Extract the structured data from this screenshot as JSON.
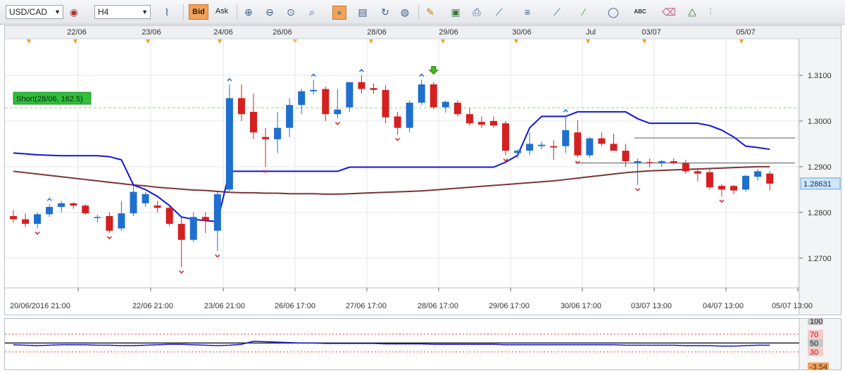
{
  "toolbar": {
    "symbol": "USD/CAD",
    "timeframe": "H4",
    "bid_label": "Bid",
    "ask_label": "Ask",
    "abc_label": "ABC"
  },
  "chart_data": [
    {
      "type": "candlestick",
      "top_date_labels": [
        "22/06",
        "23/06",
        "24/06",
        "26/06",
        "28/06",
        "29/06",
        "30/06",
        "Jul",
        "03/07",
        "05/07"
      ],
      "bottom_date_labels": [
        "20/06/2016 21:00",
        "22/06 21:00",
        "23/06 21:00",
        "26/06 17:00",
        "27/06 17:00",
        "28/06 17:00",
        "29/06 17:00",
        "30/06 17:00",
        "03/07 13:00",
        "04/07 13:00",
        "05/07 13:00"
      ],
      "y_ticks": [
        "1.3100",
        "1.3000",
        "1.2900",
        "1.2800",
        "1.2700"
      ],
      "ylim": [
        1.2635,
        1.318
      ],
      "current_price": "1.28631",
      "position_label": "Short(28/06, 162.5)",
      "position_price": 1.3029,
      "horizontal_lines": [
        1.2963,
        1.2908
      ],
      "colors": {
        "bull": "#1f6fcf",
        "bear": "#d42020",
        "channel": "#1414d8",
        "ma": "#7a3535",
        "position": "#2fbf3a"
      },
      "candles": [
        {
          "o": 1.2792,
          "h": 1.2805,
          "l": 1.2778,
          "c": 1.2785
        },
        {
          "o": 1.2785,
          "h": 1.2798,
          "l": 1.2768,
          "c": 1.2775
        },
        {
          "o": 1.2775,
          "h": 1.28,
          "l": 1.2765,
          "c": 1.2796
        },
        {
          "o": 1.2796,
          "h": 1.2818,
          "l": 1.279,
          "c": 1.2812
        },
        {
          "o": 1.2812,
          "h": 1.2825,
          "l": 1.28,
          "c": 1.282
        },
        {
          "o": 1.282,
          "h": 1.2822,
          "l": 1.2808,
          "c": 1.2815
        },
        {
          "o": 1.2815,
          "h": 1.2818,
          "l": 1.2795,
          "c": 1.2798
        },
        {
          "o": 1.279,
          "h": 1.2795,
          "l": 1.2778,
          "c": 1.279
        },
        {
          "o": 1.2792,
          "h": 1.28,
          "l": 1.2755,
          "c": 1.276
        },
        {
          "o": 1.2765,
          "h": 1.2825,
          "l": 1.276,
          "c": 1.2798
        },
        {
          "o": 1.2798,
          "h": 1.2858,
          "l": 1.2792,
          "c": 1.2845
        },
        {
          "o": 1.282,
          "h": 1.2845,
          "l": 1.2812,
          "c": 1.284
        },
        {
          "o": 1.2815,
          "h": 1.2825,
          "l": 1.28,
          "c": 1.281
        },
        {
          "o": 1.281,
          "h": 1.2815,
          "l": 1.277,
          "c": 1.2775
        },
        {
          "o": 1.2775,
          "h": 1.279,
          "l": 1.268,
          "c": 1.274
        },
        {
          "o": 1.274,
          "h": 1.28,
          "l": 1.2735,
          "c": 1.279
        },
        {
          "o": 1.279,
          "h": 1.28,
          "l": 1.2755,
          "c": 1.2782
        },
        {
          "o": 1.276,
          "h": 1.2845,
          "l": 1.2715,
          "c": 1.284
        },
        {
          "o": 1.285,
          "h": 1.308,
          "l": 1.2845,
          "c": 1.305
        },
        {
          "o": 1.305,
          "h": 1.308,
          "l": 1.3,
          "c": 1.3015
        },
        {
          "o": 1.302,
          "h": 1.306,
          "l": 1.296,
          "c": 1.2975
        },
        {
          "o": 1.2965,
          "h": 1.2985,
          "l": 1.29,
          "c": 1.296
        },
        {
          "o": 1.296,
          "h": 1.302,
          "l": 1.293,
          "c": 1.2985
        },
        {
          "o": 1.2985,
          "h": 1.305,
          "l": 1.2965,
          "c": 1.3035
        },
        {
          "o": 1.3035,
          "h": 1.307,
          "l": 1.3015,
          "c": 1.3065
        },
        {
          "o": 1.3065,
          "h": 1.309,
          "l": 1.3058,
          "c": 1.3068
        },
        {
          "o": 1.307,
          "h": 1.3075,
          "l": 1.3,
          "c": 1.3015
        },
        {
          "o": 1.3015,
          "h": 1.307,
          "l": 1.3005,
          "c": 1.3025
        },
        {
          "o": 1.303,
          "h": 1.308,
          "l": 1.302,
          "c": 1.3085
        },
        {
          "o": 1.3085,
          "h": 1.31,
          "l": 1.306,
          "c": 1.307
        },
        {
          "o": 1.3072,
          "h": 1.3082,
          "l": 1.306,
          "c": 1.3068
        },
        {
          "o": 1.3068,
          "h": 1.3078,
          "l": 1.2995,
          "c": 1.3008
        },
        {
          "o": 1.301,
          "h": 1.302,
          "l": 1.297,
          "c": 1.2985
        },
        {
          "o": 1.2985,
          "h": 1.3045,
          "l": 1.2975,
          "c": 1.304
        },
        {
          "o": 1.304,
          "h": 1.309,
          "l": 1.3035,
          "c": 1.308
        },
        {
          "o": 1.308,
          "h": 1.3085,
          "l": 1.3025,
          "c": 1.303
        },
        {
          "o": 1.303,
          "h": 1.3045,
          "l": 1.3018,
          "c": 1.3042
        },
        {
          "o": 1.304,
          "h": 1.3045,
          "l": 1.301,
          "c": 1.3015
        },
        {
          "o": 1.3015,
          "h": 1.3028,
          "l": 1.299,
          "c": 1.2995
        },
        {
          "o": 1.2998,
          "h": 1.301,
          "l": 1.2985,
          "c": 1.2992
        },
        {
          "o": 1.3,
          "h": 1.301,
          "l": 1.2985,
          "c": 1.299
        },
        {
          "o": 1.2995,
          "h": 1.3,
          "l": 1.2925,
          "c": 1.2935
        },
        {
          "o": 1.293,
          "h": 1.2938,
          "l": 1.2918,
          "c": 1.2935
        },
        {
          "o": 1.2935,
          "h": 1.2975,
          "l": 1.2925,
          "c": 1.295
        },
        {
          "o": 1.2945,
          "h": 1.2955,
          "l": 1.2938,
          "c": 1.2948
        },
        {
          "o": 1.2945,
          "h": 1.2958,
          "l": 1.2915,
          "c": 1.2942
        },
        {
          "o": 1.2945,
          "h": 1.3012,
          "l": 1.293,
          "c": 1.298
        },
        {
          "o": 1.2975,
          "h": 1.3002,
          "l": 1.292,
          "c": 1.2925
        },
        {
          "o": 1.2925,
          "h": 1.2965,
          "l": 1.292,
          "c": 1.2962
        },
        {
          "o": 1.2962,
          "h": 1.2975,
          "l": 1.2945,
          "c": 1.295
        },
        {
          "o": 1.295,
          "h": 1.2972,
          "l": 1.2935,
          "c": 1.2935
        },
        {
          "o": 1.2935,
          "h": 1.295,
          "l": 1.29,
          "c": 1.2912
        },
        {
          "o": 1.2908,
          "h": 1.2918,
          "l": 1.286,
          "c": 1.2912
        },
        {
          "o": 1.291,
          "h": 1.2918,
          "l": 1.2898,
          "c": 1.2908
        },
        {
          "o": 1.2908,
          "h": 1.2915,
          "l": 1.29,
          "c": 1.2912
        },
        {
          "o": 1.2912,
          "h": 1.2918,
          "l": 1.2905,
          "c": 1.2908
        },
        {
          "o": 1.2908,
          "h": 1.2915,
          "l": 1.2885,
          "c": 1.289
        },
        {
          "o": 1.289,
          "h": 1.2895,
          "l": 1.2868,
          "c": 1.2885
        },
        {
          "o": 1.2888,
          "h": 1.2895,
          "l": 1.285,
          "c": 1.2855
        },
        {
          "o": 1.2858,
          "h": 1.2862,
          "l": 1.2835,
          "c": 1.285
        },
        {
          "o": 1.2858,
          "h": 1.286,
          "l": 1.284,
          "c": 1.2848
        },
        {
          "o": 1.285,
          "h": 1.2882,
          "l": 1.2845,
          "c": 1.288
        },
        {
          "o": 1.2878,
          "h": 1.2895,
          "l": 1.287,
          "c": 1.289
        },
        {
          "o": 1.2885,
          "h": 1.289,
          "l": 1.2848,
          "c": 1.2863
        }
      ],
      "channel": [
        1.293,
        1.2928,
        1.2926,
        1.2925,
        1.2924,
        1.2924,
        1.2924,
        1.2924,
        1.2922,
        1.2915,
        1.286,
        1.285,
        1.2835,
        1.2815,
        1.279,
        1.2785,
        1.2782,
        1.278,
        1.289,
        1.289,
        1.289,
        1.289,
        1.289,
        1.289,
        1.289,
        1.289,
        1.289,
        1.289,
        1.2899,
        1.2899,
        1.2899,
        1.2899,
        1.2899,
        1.2899,
        1.2899,
        1.2899,
        1.2899,
        1.2899,
        1.2899,
        1.2899,
        1.2899,
        1.291,
        1.2925,
        1.2985,
        1.301,
        1.301,
        1.301,
        1.302,
        1.302,
        1.302,
        1.302,
        1.302,
        1.3005,
        1.2995,
        1.2995,
        1.2995,
        1.2995,
        1.2995,
        1.299,
        1.298,
        1.2965,
        1.2945,
        1.2942,
        1.2938
      ],
      "ma": [
        1.289,
        1.2887,
        1.2884,
        1.2881,
        1.2878,
        1.2875,
        1.2872,
        1.2869,
        1.2866,
        1.2863,
        1.286,
        1.2858,
        1.2855,
        1.2853,
        1.2851,
        1.2849,
        1.2848,
        1.2846,
        1.2844,
        1.2843,
        1.2843,
        1.2842,
        1.2842,
        1.2841,
        1.2841,
        1.2841,
        1.284,
        1.284,
        1.2841,
        1.2842,
        1.2843,
        1.2844,
        1.2845,
        1.2846,
        1.2847,
        1.2849,
        1.2851,
        1.2853,
        1.2855,
        1.2857,
        1.2859,
        1.2861,
        1.2863,
        1.2865,
        1.2867,
        1.2869,
        1.2872,
        1.2875,
        1.2878,
        1.2881,
        1.2884,
        1.2887,
        1.2889,
        1.2891,
        1.2892,
        1.2893,
        1.2894,
        1.2895,
        1.2896,
        1.2897,
        1.2898,
        1.2899,
        1.29,
        1.29
      ]
    },
    {
      "type": "line",
      "y_ticks": [
        "100",
        "70",
        "50",
        "30",
        "-3.54"
      ],
      "ylim": [
        -3.54,
        100
      ],
      "levels": [
        70,
        50,
        30
      ],
      "values": [
        46,
        45,
        44,
        45,
        46,
        46,
        46,
        45,
        45,
        44,
        44,
        45,
        46,
        47,
        47,
        46,
        45,
        44,
        45,
        47,
        54,
        53,
        52,
        51,
        50,
        50,
        49,
        49,
        49,
        49,
        49,
        48,
        48,
        48,
        48,
        47,
        47,
        47,
        47,
        47,
        47,
        46,
        46,
        46,
        46,
        46,
        46,
        46,
        46,
        46,
        46,
        45,
        45,
        45,
        45,
        45,
        44,
        44,
        44,
        43,
        43,
        44,
        45,
        45
      ]
    }
  ]
}
